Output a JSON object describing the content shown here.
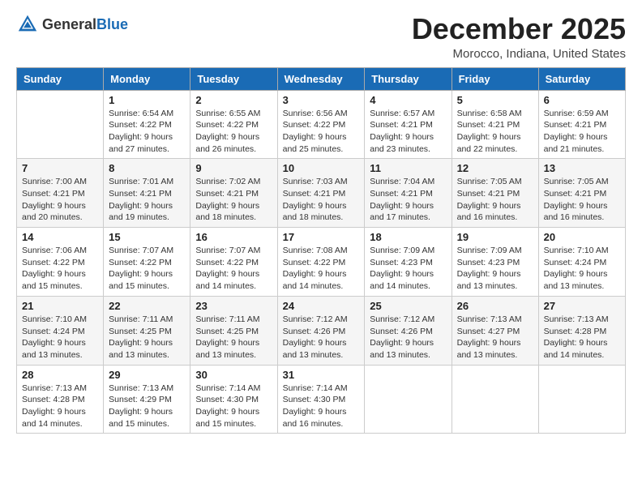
{
  "header": {
    "logo_general": "General",
    "logo_blue": "Blue",
    "title": "December 2025",
    "subtitle": "Morocco, Indiana, United States"
  },
  "days_of_week": [
    "Sunday",
    "Monday",
    "Tuesday",
    "Wednesday",
    "Thursday",
    "Friday",
    "Saturday"
  ],
  "weeks": [
    [
      {
        "day": "",
        "sunrise": "",
        "sunset": "",
        "daylight": ""
      },
      {
        "day": "1",
        "sunrise": "Sunrise: 6:54 AM",
        "sunset": "Sunset: 4:22 PM",
        "daylight": "Daylight: 9 hours and 27 minutes."
      },
      {
        "day": "2",
        "sunrise": "Sunrise: 6:55 AM",
        "sunset": "Sunset: 4:22 PM",
        "daylight": "Daylight: 9 hours and 26 minutes."
      },
      {
        "day": "3",
        "sunrise": "Sunrise: 6:56 AM",
        "sunset": "Sunset: 4:22 PM",
        "daylight": "Daylight: 9 hours and 25 minutes."
      },
      {
        "day": "4",
        "sunrise": "Sunrise: 6:57 AM",
        "sunset": "Sunset: 4:21 PM",
        "daylight": "Daylight: 9 hours and 23 minutes."
      },
      {
        "day": "5",
        "sunrise": "Sunrise: 6:58 AM",
        "sunset": "Sunset: 4:21 PM",
        "daylight": "Daylight: 9 hours and 22 minutes."
      },
      {
        "day": "6",
        "sunrise": "Sunrise: 6:59 AM",
        "sunset": "Sunset: 4:21 PM",
        "daylight": "Daylight: 9 hours and 21 minutes."
      }
    ],
    [
      {
        "day": "7",
        "sunrise": "Sunrise: 7:00 AM",
        "sunset": "Sunset: 4:21 PM",
        "daylight": "Daylight: 9 hours and 20 minutes."
      },
      {
        "day": "8",
        "sunrise": "Sunrise: 7:01 AM",
        "sunset": "Sunset: 4:21 PM",
        "daylight": "Daylight: 9 hours and 19 minutes."
      },
      {
        "day": "9",
        "sunrise": "Sunrise: 7:02 AM",
        "sunset": "Sunset: 4:21 PM",
        "daylight": "Daylight: 9 hours and 18 minutes."
      },
      {
        "day": "10",
        "sunrise": "Sunrise: 7:03 AM",
        "sunset": "Sunset: 4:21 PM",
        "daylight": "Daylight: 9 hours and 18 minutes."
      },
      {
        "day": "11",
        "sunrise": "Sunrise: 7:04 AM",
        "sunset": "Sunset: 4:21 PM",
        "daylight": "Daylight: 9 hours and 17 minutes."
      },
      {
        "day": "12",
        "sunrise": "Sunrise: 7:05 AM",
        "sunset": "Sunset: 4:21 PM",
        "daylight": "Daylight: 9 hours and 16 minutes."
      },
      {
        "day": "13",
        "sunrise": "Sunrise: 7:05 AM",
        "sunset": "Sunset: 4:21 PM",
        "daylight": "Daylight: 9 hours and 16 minutes."
      }
    ],
    [
      {
        "day": "14",
        "sunrise": "Sunrise: 7:06 AM",
        "sunset": "Sunset: 4:22 PM",
        "daylight": "Daylight: 9 hours and 15 minutes."
      },
      {
        "day": "15",
        "sunrise": "Sunrise: 7:07 AM",
        "sunset": "Sunset: 4:22 PM",
        "daylight": "Daylight: 9 hours and 15 minutes."
      },
      {
        "day": "16",
        "sunrise": "Sunrise: 7:07 AM",
        "sunset": "Sunset: 4:22 PM",
        "daylight": "Daylight: 9 hours and 14 minutes."
      },
      {
        "day": "17",
        "sunrise": "Sunrise: 7:08 AM",
        "sunset": "Sunset: 4:22 PM",
        "daylight": "Daylight: 9 hours and 14 minutes."
      },
      {
        "day": "18",
        "sunrise": "Sunrise: 7:09 AM",
        "sunset": "Sunset: 4:23 PM",
        "daylight": "Daylight: 9 hours and 14 minutes."
      },
      {
        "day": "19",
        "sunrise": "Sunrise: 7:09 AM",
        "sunset": "Sunset: 4:23 PM",
        "daylight": "Daylight: 9 hours and 13 minutes."
      },
      {
        "day": "20",
        "sunrise": "Sunrise: 7:10 AM",
        "sunset": "Sunset: 4:24 PM",
        "daylight": "Daylight: 9 hours and 13 minutes."
      }
    ],
    [
      {
        "day": "21",
        "sunrise": "Sunrise: 7:10 AM",
        "sunset": "Sunset: 4:24 PM",
        "daylight": "Daylight: 9 hours and 13 minutes."
      },
      {
        "day": "22",
        "sunrise": "Sunrise: 7:11 AM",
        "sunset": "Sunset: 4:25 PM",
        "daylight": "Daylight: 9 hours and 13 minutes."
      },
      {
        "day": "23",
        "sunrise": "Sunrise: 7:11 AM",
        "sunset": "Sunset: 4:25 PM",
        "daylight": "Daylight: 9 hours and 13 minutes."
      },
      {
        "day": "24",
        "sunrise": "Sunrise: 7:12 AM",
        "sunset": "Sunset: 4:26 PM",
        "daylight": "Daylight: 9 hours and 13 minutes."
      },
      {
        "day": "25",
        "sunrise": "Sunrise: 7:12 AM",
        "sunset": "Sunset: 4:26 PM",
        "daylight": "Daylight: 9 hours and 13 minutes."
      },
      {
        "day": "26",
        "sunrise": "Sunrise: 7:13 AM",
        "sunset": "Sunset: 4:27 PM",
        "daylight": "Daylight: 9 hours and 13 minutes."
      },
      {
        "day": "27",
        "sunrise": "Sunrise: 7:13 AM",
        "sunset": "Sunset: 4:28 PM",
        "daylight": "Daylight: 9 hours and 14 minutes."
      }
    ],
    [
      {
        "day": "28",
        "sunrise": "Sunrise: 7:13 AM",
        "sunset": "Sunset: 4:28 PM",
        "daylight": "Daylight: 9 hours and 14 minutes."
      },
      {
        "day": "29",
        "sunrise": "Sunrise: 7:13 AM",
        "sunset": "Sunset: 4:29 PM",
        "daylight": "Daylight: 9 hours and 15 minutes."
      },
      {
        "day": "30",
        "sunrise": "Sunrise: 7:14 AM",
        "sunset": "Sunset: 4:30 PM",
        "daylight": "Daylight: 9 hours and 15 minutes."
      },
      {
        "day": "31",
        "sunrise": "Sunrise: 7:14 AM",
        "sunset": "Sunset: 4:30 PM",
        "daylight": "Daylight: 9 hours and 16 minutes."
      },
      {
        "day": "",
        "sunrise": "",
        "sunset": "",
        "daylight": ""
      },
      {
        "day": "",
        "sunrise": "",
        "sunset": "",
        "daylight": ""
      },
      {
        "day": "",
        "sunrise": "",
        "sunset": "",
        "daylight": ""
      }
    ]
  ]
}
